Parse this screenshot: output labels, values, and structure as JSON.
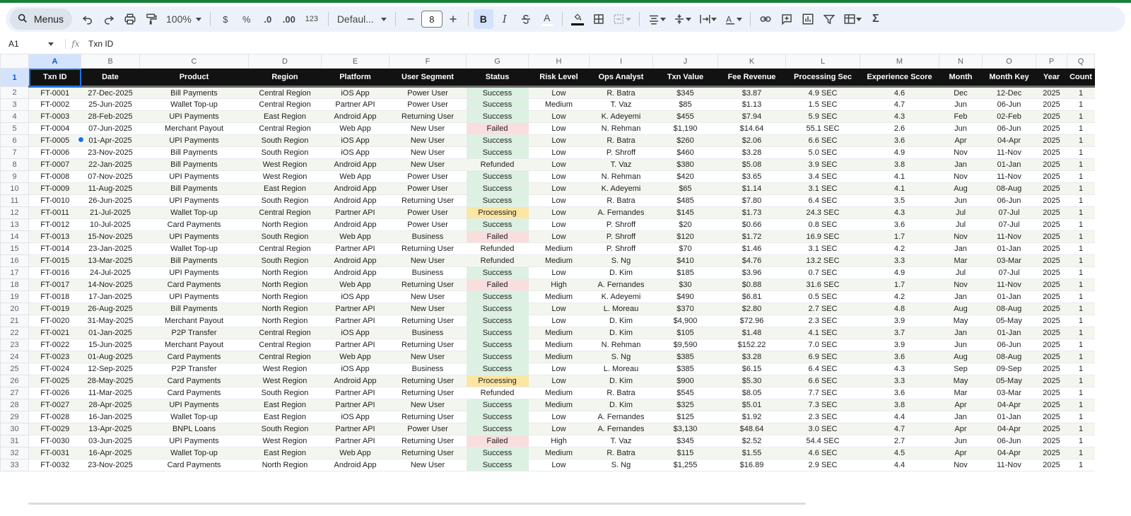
{
  "toolbar": {
    "menus_label": "Menus",
    "zoom": "100%",
    "currency_symbol": "$",
    "percent_symbol": "%",
    "decrease_decimal_label": ".0",
    "increase_decimal_label": ".00",
    "number_format_label": "123",
    "font": "Defaul...",
    "font_size": "8",
    "bold_label": "B",
    "italic_label": "I",
    "text_color_label": "A",
    "sum_label": "Σ"
  },
  "formula_bar": {
    "cell_ref": "A1",
    "fx": "fx",
    "content": "Txn ID"
  },
  "columns": [
    "A",
    "B",
    "C",
    "D",
    "E",
    "F",
    "G",
    "H",
    "I",
    "J",
    "K",
    "L",
    "M",
    "N",
    "O",
    "P",
    "Q"
  ],
  "headers": [
    "Txn ID",
    "Date",
    "Product",
    "Region",
    "Platform",
    "User Segment",
    "Status",
    "Risk Level",
    "Ops Analyst",
    "Txn Value",
    "Fee Revenue",
    "Processing Sec",
    "Experience Score",
    "Month",
    "Month Key",
    "Year",
    "Count"
  ],
  "rows": [
    [
      "FT-0001",
      "27-Dec-2025",
      "Bill Payments",
      "Central Region",
      "iOS App",
      "Power User",
      "Success",
      "Low",
      "R. Batra",
      "$345",
      "$3.87",
      "4.9 SEC",
      "4.6",
      "Dec",
      "12-Dec",
      "2025",
      "1"
    ],
    [
      "FT-0002",
      "25-Jun-2025",
      "Wallet Top-up",
      "Central Region",
      "Partner API",
      "Power User",
      "Success",
      "Medium",
      "T. Vaz",
      "$85",
      "$1.13",
      "1.5 SEC",
      "4.7",
      "Jun",
      "06-Jun",
      "2025",
      "1"
    ],
    [
      "FT-0003",
      "28-Feb-2025",
      "UPI Payments",
      "East Region",
      "Android App",
      "Returning User",
      "Success",
      "Low",
      "K. Adeyemi",
      "$455",
      "$7.94",
      "5.9 SEC",
      "4.3",
      "Feb",
      "02-Feb",
      "2025",
      "1"
    ],
    [
      "FT-0004",
      "07-Jun-2025",
      "Merchant Payout",
      "Central Region",
      "Web App",
      "New User",
      "Failed",
      "Low",
      "N. Rehman",
      "$1,190",
      "$14.64",
      "55.1 SEC",
      "2.6",
      "Jun",
      "06-Jun",
      "2025",
      "1"
    ],
    [
      "FT-0005",
      "01-Apr-2025",
      "UPI Payments",
      "South Region",
      "iOS App",
      "New User",
      "Success",
      "Low",
      "R. Batra",
      "$260",
      "$2.06",
      "6.6 SEC",
      "3.6",
      "Apr",
      "04-Apr",
      "2025",
      "1"
    ],
    [
      "FT-0006",
      "23-Nov-2025",
      "Bill Payments",
      "South Region",
      "iOS App",
      "New User",
      "Success",
      "Low",
      "P. Shroff",
      "$460",
      "$3.28",
      "5.0 SEC",
      "4.9",
      "Nov",
      "11-Nov",
      "2025",
      "1"
    ],
    [
      "FT-0007",
      "22-Jan-2025",
      "Bill Payments",
      "West Region",
      "Android App",
      "New User",
      "Refunded",
      "Low",
      "T. Vaz",
      "$380",
      "$5.08",
      "3.9 SEC",
      "3.8",
      "Jan",
      "01-Jan",
      "2025",
      "1"
    ],
    [
      "FT-0008",
      "07-Nov-2025",
      "UPI Payments",
      "West Region",
      "Web App",
      "Power User",
      "Success",
      "Low",
      "N. Rehman",
      "$420",
      "$3.65",
      "3.4 SEC",
      "4.1",
      "Nov",
      "11-Nov",
      "2025",
      "1"
    ],
    [
      "FT-0009",
      "11-Aug-2025",
      "Bill Payments",
      "East Region",
      "Android App",
      "Power User",
      "Success",
      "Low",
      "K. Adeyemi",
      "$65",
      "$1.14",
      "3.1 SEC",
      "4.1",
      "Aug",
      "08-Aug",
      "2025",
      "1"
    ],
    [
      "FT-0010",
      "26-Jun-2025",
      "UPI Payments",
      "South Region",
      "Android App",
      "Returning User",
      "Success",
      "Low",
      "R. Batra",
      "$485",
      "$7.80",
      "6.4 SEC",
      "3.5",
      "Jun",
      "06-Jun",
      "2025",
      "1"
    ],
    [
      "FT-0011",
      "21-Jul-2025",
      "Wallet Top-up",
      "Central Region",
      "Partner API",
      "Power User",
      "Processing",
      "Low",
      "A. Fernandes",
      "$145",
      "$1.73",
      "24.3 SEC",
      "4.3",
      "Jul",
      "07-Jul",
      "2025",
      "1"
    ],
    [
      "FT-0012",
      "10-Jul-2025",
      "Card Payments",
      "North Region",
      "Android App",
      "Power User",
      "Success",
      "Low",
      "P. Shroff",
      "$20",
      "$0.66",
      "0.8 SEC",
      "3.6",
      "Jul",
      "07-Jul",
      "2025",
      "1"
    ],
    [
      "FT-0013",
      "15-Nov-2025",
      "UPI Payments",
      "South Region",
      "Web App",
      "Business",
      "Failed",
      "Low",
      "P. Shroff",
      "$120",
      "$1.72",
      "16.9 SEC",
      "1.7",
      "Nov",
      "11-Nov",
      "2025",
      "1"
    ],
    [
      "FT-0014",
      "23-Jan-2025",
      "Wallet Top-up",
      "Central Region",
      "Partner API",
      "Returning User",
      "Refunded",
      "Medium",
      "P. Shroff",
      "$70",
      "$1.46",
      "3.1 SEC",
      "4.2",
      "Jan",
      "01-Jan",
      "2025",
      "1"
    ],
    [
      "FT-0015",
      "13-Mar-2025",
      "Bill Payments",
      "South Region",
      "Android App",
      "New User",
      "Refunded",
      "Medium",
      "S. Ng",
      "$410",
      "$4.76",
      "13.2 SEC",
      "3.3",
      "Mar",
      "03-Mar",
      "2025",
      "1"
    ],
    [
      "FT-0016",
      "24-Jul-2025",
      "UPI Payments",
      "North Region",
      "Android App",
      "Business",
      "Success",
      "Low",
      "D. Kim",
      "$185",
      "$3.96",
      "0.7 SEC",
      "4.9",
      "Jul",
      "07-Jul",
      "2025",
      "1"
    ],
    [
      "FT-0017",
      "14-Nov-2025",
      "Card Payments",
      "North Region",
      "Web App",
      "Returning User",
      "Failed",
      "High",
      "A. Fernandes",
      "$30",
      "$0.88",
      "31.6 SEC",
      "1.7",
      "Nov",
      "11-Nov",
      "2025",
      "1"
    ],
    [
      "FT-0018",
      "17-Jan-2025",
      "UPI Payments",
      "North Region",
      "iOS App",
      "New User",
      "Success",
      "Medium",
      "K. Adeyemi",
      "$490",
      "$6.81",
      "0.5 SEC",
      "4.2",
      "Jan",
      "01-Jan",
      "2025",
      "1"
    ],
    [
      "FT-0019",
      "26-Aug-2025",
      "Bill Payments",
      "North Region",
      "Partner API",
      "New User",
      "Success",
      "Low",
      "L. Moreau",
      "$370",
      "$2.80",
      "2.7 SEC",
      "4.8",
      "Aug",
      "08-Aug",
      "2025",
      "1"
    ],
    [
      "FT-0020",
      "31-May-2025",
      "Merchant Payout",
      "North Region",
      "Partner API",
      "Returning User",
      "Success",
      "Low",
      "D. Kim",
      "$4,900",
      "$72.96",
      "2.3 SEC",
      "3.9",
      "May",
      "05-May",
      "2025",
      "1"
    ],
    [
      "FT-0021",
      "01-Jan-2025",
      "P2P Transfer",
      "Central Region",
      "iOS App",
      "Business",
      "Success",
      "Medium",
      "D. Kim",
      "$105",
      "$1.48",
      "4.1 SEC",
      "3.7",
      "Jan",
      "01-Jan",
      "2025",
      "1"
    ],
    [
      "FT-0022",
      "15-Jun-2025",
      "Merchant Payout",
      "Central Region",
      "Partner API",
      "Returning User",
      "Success",
      "Medium",
      "N. Rehman",
      "$9,590",
      "$152.22",
      "7.0 SEC",
      "3.9",
      "Jun",
      "06-Jun",
      "2025",
      "1"
    ],
    [
      "FT-0023",
      "01-Aug-2025",
      "Card Payments",
      "Central Region",
      "Web App",
      "New User",
      "Success",
      "Medium",
      "S. Ng",
      "$385",
      "$3.28",
      "6.9 SEC",
      "3.6",
      "Aug",
      "08-Aug",
      "2025",
      "1"
    ],
    [
      "FT-0024",
      "12-Sep-2025",
      "P2P Transfer",
      "West Region",
      "iOS App",
      "Business",
      "Success",
      "Low",
      "L. Moreau",
      "$385",
      "$6.15",
      "6.4 SEC",
      "4.3",
      "Sep",
      "09-Sep",
      "2025",
      "1"
    ],
    [
      "FT-0025",
      "28-May-2025",
      "Card Payments",
      "West Region",
      "Android App",
      "Returning User",
      "Processing",
      "Low",
      "D. Kim",
      "$900",
      "$5.30",
      "6.6 SEC",
      "3.3",
      "May",
      "05-May",
      "2025",
      "1"
    ],
    [
      "FT-0026",
      "11-Mar-2025",
      "Card Payments",
      "South Region",
      "Partner API",
      "Returning User",
      "Refunded",
      "Medium",
      "R. Batra",
      "$545",
      "$8.05",
      "7.7 SEC",
      "3.6",
      "Mar",
      "03-Mar",
      "2025",
      "1"
    ],
    [
      "FT-0027",
      "28-Apr-2025",
      "UPI Payments",
      "East Region",
      "Partner API",
      "New User",
      "Success",
      "Medium",
      "D. Kim",
      "$325",
      "$5.01",
      "7.3 SEC",
      "3.8",
      "Apr",
      "04-Apr",
      "2025",
      "1"
    ],
    [
      "FT-0028",
      "16-Jan-2025",
      "Wallet Top-up",
      "East Region",
      "iOS App",
      "Returning User",
      "Success",
      "Low",
      "A. Fernandes",
      "$125",
      "$1.92",
      "2.3 SEC",
      "4.4",
      "Jan",
      "01-Jan",
      "2025",
      "1"
    ],
    [
      "FT-0029",
      "13-Apr-2025",
      "BNPL Loans",
      "South Region",
      "Partner API",
      "Power User",
      "Success",
      "Low",
      "A. Fernandes",
      "$3,130",
      "$48.64",
      "3.0 SEC",
      "4.7",
      "Apr",
      "04-Apr",
      "2025",
      "1"
    ],
    [
      "FT-0030",
      "03-Jun-2025",
      "UPI Payments",
      "West Region",
      "Partner API",
      "Returning User",
      "Failed",
      "High",
      "T. Vaz",
      "$345",
      "$2.52",
      "54.4 SEC",
      "2.7",
      "Jun",
      "06-Jun",
      "2025",
      "1"
    ],
    [
      "FT-0031",
      "16-Apr-2025",
      "Wallet Top-up",
      "East Region",
      "Web App",
      "Returning User",
      "Success",
      "Medium",
      "R. Batra",
      "$115",
      "$1.55",
      "4.6 SEC",
      "4.5",
      "Apr",
      "04-Apr",
      "2025",
      "1"
    ],
    [
      "FT-0032",
      "23-Nov-2025",
      "Card Payments",
      "North Region",
      "Android App",
      "New User",
      "Success",
      "Low",
      "S. Ng",
      "$1,255",
      "$16.89",
      "2.9 SEC",
      "4.4",
      "Nov",
      "11-Nov",
      "2025",
      "1"
    ]
  ],
  "status_colors": {
    "Success": "#dcf1e2",
    "Failed": "#f9dede",
    "Processing": "#fbe6a2"
  },
  "icons": [
    "search-icon",
    "undo-icon",
    "redo-icon",
    "print-icon",
    "paint-format-icon",
    "fill-color-icon",
    "borders-icon",
    "merge-icon",
    "align-icon",
    "valign-icon",
    "wrap-icon",
    "rotate-icon",
    "link-icon",
    "comment-icon",
    "chart-icon",
    "filter-icon",
    "functions-icon"
  ]
}
